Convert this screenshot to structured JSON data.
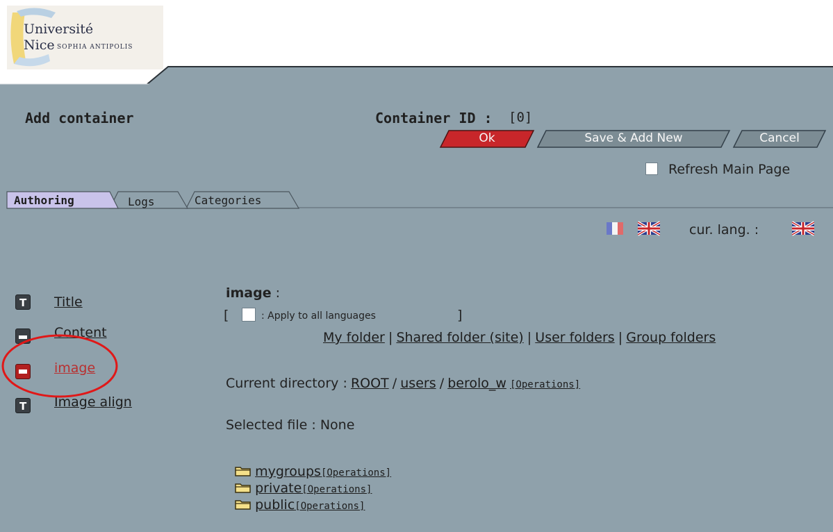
{
  "logo": {
    "line1": "Université",
    "line2": "Nice",
    "subtitle": "SOPHIA ANTIPOLIS"
  },
  "page": {
    "title": "Add container",
    "container_id_label": "Container ID :",
    "container_id_value": "[0]"
  },
  "buttons": {
    "ok": "Ok",
    "save_add_new": "Save & Add New",
    "cancel": "Cancel"
  },
  "refresh": {
    "label": "Refresh Main Page",
    "checked": false
  },
  "tabs": [
    {
      "label": "Authoring",
      "active": true
    },
    {
      "label": "Logs",
      "active": false
    },
    {
      "label": "Categories",
      "active": false
    }
  ],
  "language": {
    "cur_label": "cur. lang. :"
  },
  "fields": [
    {
      "label": "Title",
      "icon": "text-field-icon",
      "selected": false
    },
    {
      "label": "Content",
      "icon": "bigtext-field-icon",
      "selected": false
    },
    {
      "label": "image",
      "icon": "file-field-icon",
      "selected": true
    },
    {
      "label": "Image align",
      "icon": "text-field-icon",
      "selected": false
    }
  ],
  "editor": {
    "field_name": "image",
    "colon": ":",
    "apply_all_open": "[",
    "apply_all_label": ": Apply to all languages",
    "apply_all_close": "]",
    "folder_links": [
      "My folder",
      "Shared folder (site)",
      "User folders",
      "Group folders"
    ],
    "separator": "|",
    "current_dir_label": "Current directory :",
    "path": [
      "ROOT",
      "users",
      "berolo_w"
    ],
    "path_sep": "/",
    "operations": "[Operations]",
    "selected_file_label": "Selected file : None",
    "folders": [
      "mygroups",
      "private",
      "public"
    ]
  },
  "colors": {
    "panel_bg": "#8fa1ab",
    "ok_button": "#c8262a",
    "grey_button": "#7c8c94",
    "tab_active": "#c9c3ea",
    "annotation_circle": "#e01818",
    "selected_field_text": "#b83030"
  }
}
